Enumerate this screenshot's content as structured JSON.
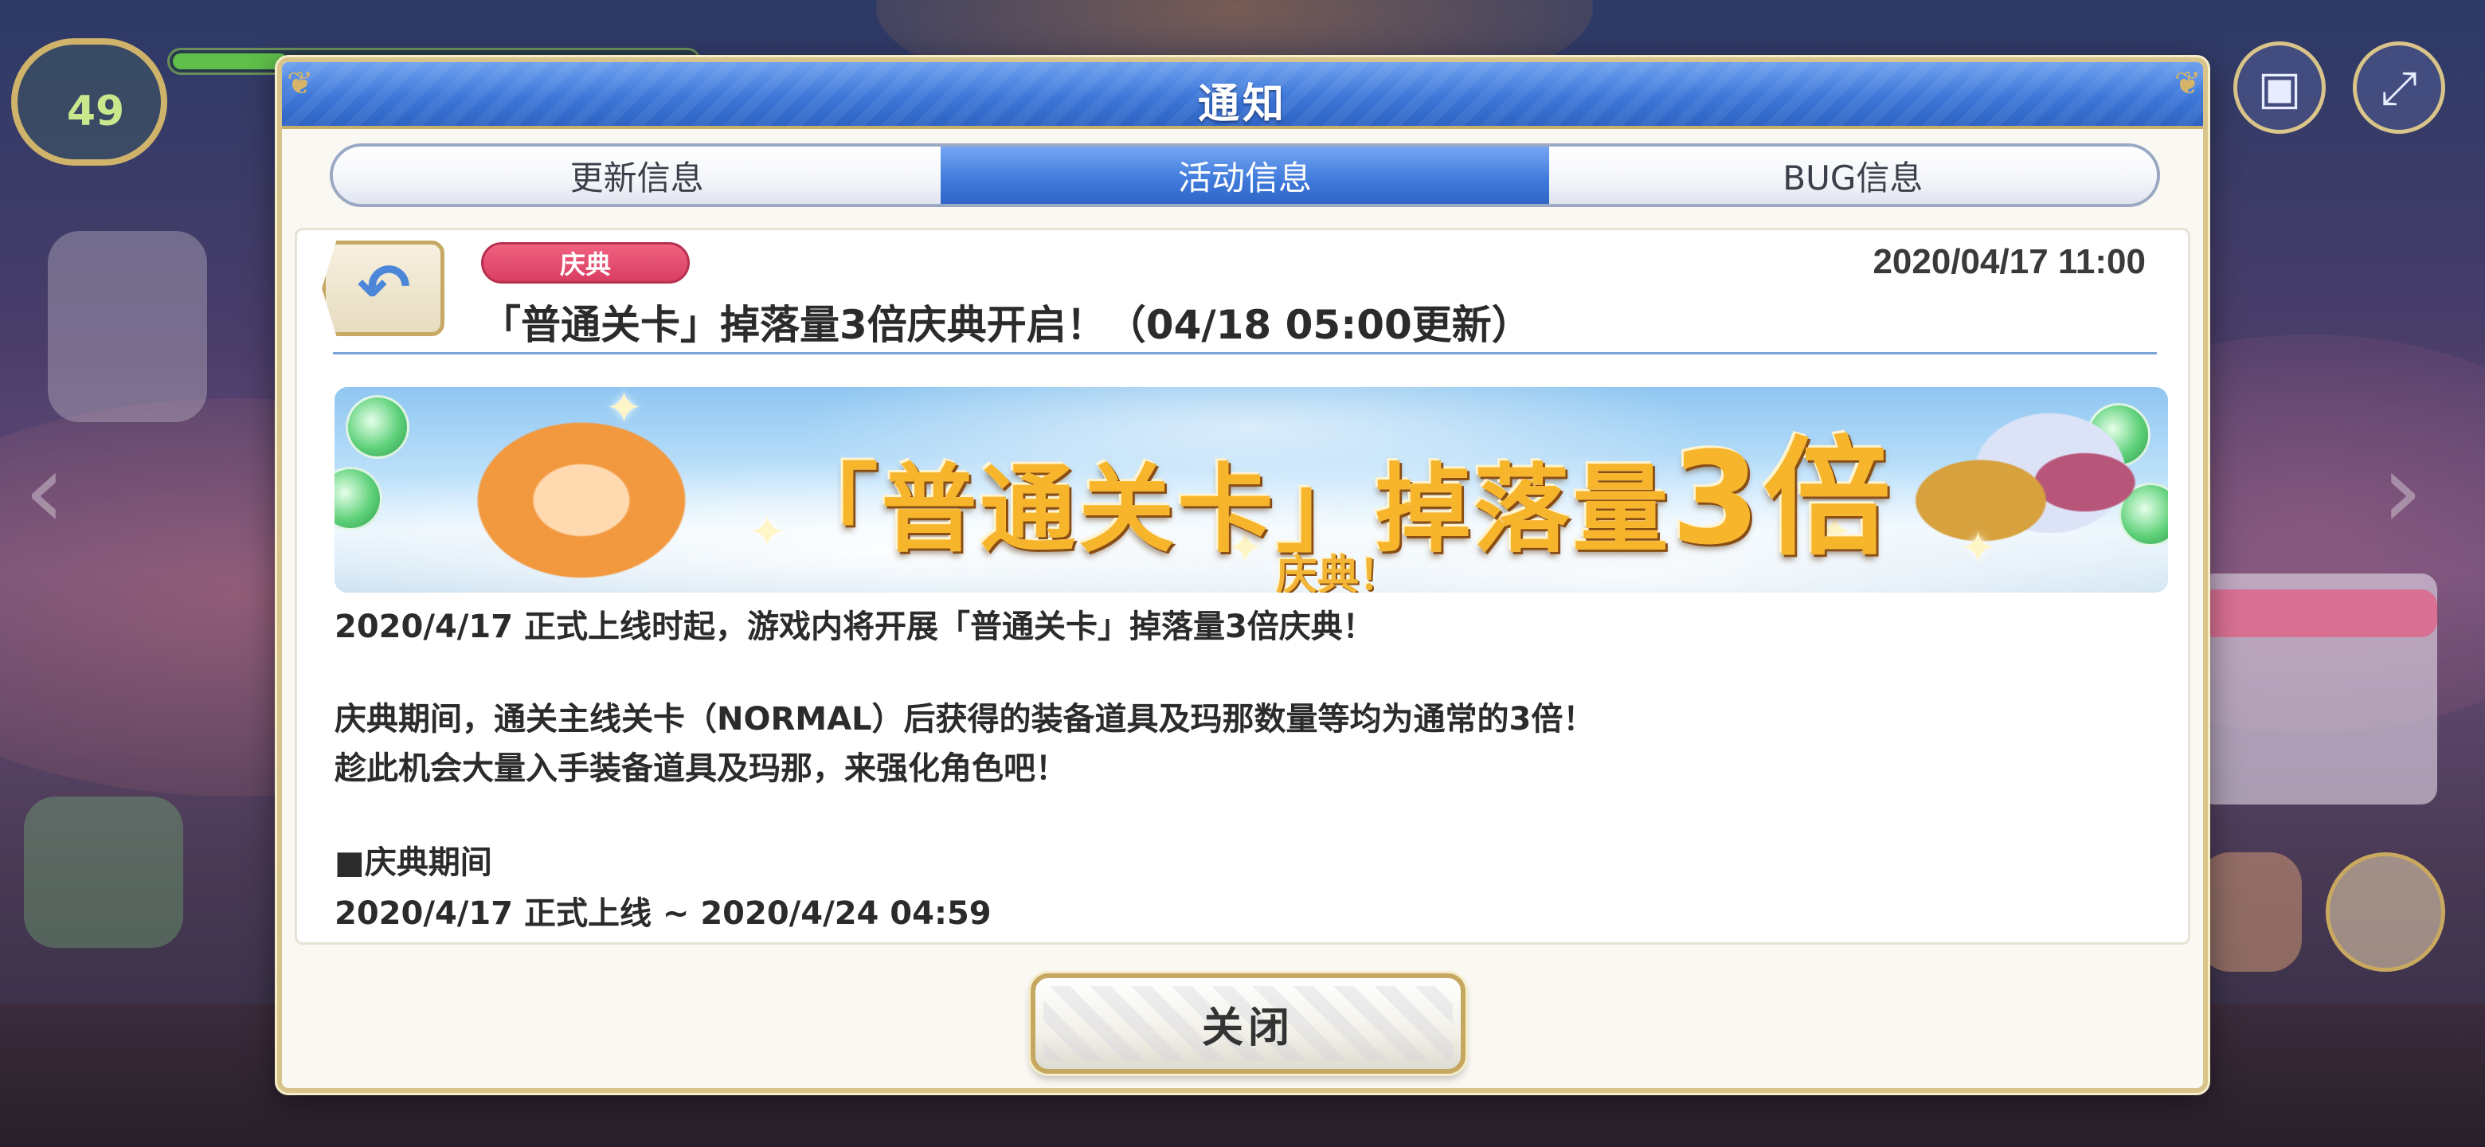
{
  "window": {
    "title": "通知"
  },
  "tabs": [
    {
      "label": "更新信息",
      "active": false
    },
    {
      "label": "活动信息",
      "active": true
    },
    {
      "label": "BUG信息",
      "active": false
    }
  ],
  "article": {
    "tag": "庆典",
    "date": "2020/04/17 11:00",
    "headline": "「普通关卡」掉落量3倍庆典开启！（04/18 05:00更新）",
    "banner": {
      "main_prefix": "「普通关卡」掉落量",
      "main_big": "3倍",
      "sub": "庆典！"
    },
    "body": [
      "2020/4/17 正式上线时起，游戏内将开展「普通关卡」掉落量3倍庆典！",
      "庆典期间，通关主线关卡（NORMAL）后获得的装备道具及玛那数量等均为通常的3倍！",
      "趁此机会大量入手装备道具及玛那，来强化角色吧！",
      "■庆典期间",
      "2020/4/17 正式上线 ~ 2020/4/24 04:59"
    ]
  },
  "buttons": {
    "close_label": "关闭"
  },
  "hud": {
    "level": "49",
    "exp_fraction": 0.22,
    "icons": [
      "menu-icon",
      "fullscreen-icon",
      "back-arrow-icon",
      "left-arrow-icon",
      "right-arrow-icon"
    ]
  },
  "colors": {
    "header_blue": "#3d77d8",
    "tab_active": "#3f79db",
    "tag_pink": "#d93e62",
    "gold_border": "#c4a85f",
    "banner_gold": "#f6b52a"
  }
}
